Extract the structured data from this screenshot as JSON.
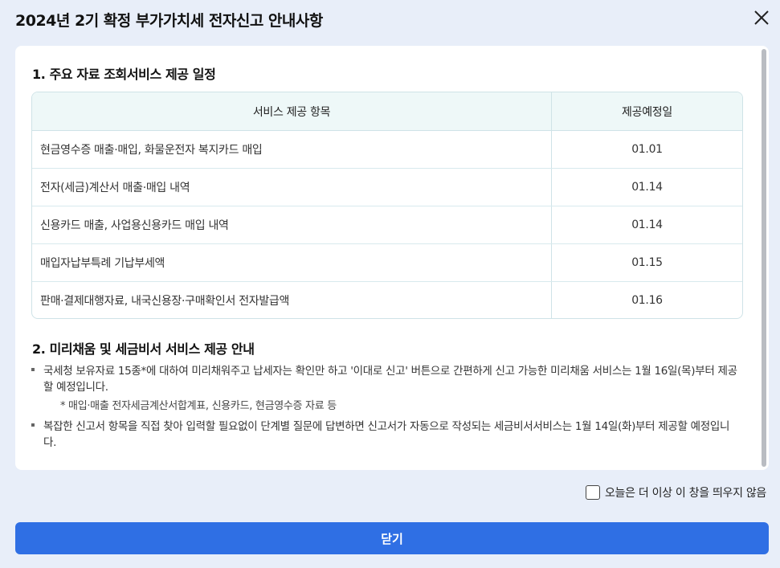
{
  "dialog": {
    "title": "2024년 2기 확정 부가가치세 전자신고 안내사항",
    "close_icon": "close-icon"
  },
  "section1": {
    "title": "1. 주요 자료 조회서비스 제공 일정",
    "table": {
      "headers": [
        "서비스 제공 항목",
        "제공예정일"
      ],
      "rows": [
        {
          "item": "현금영수증 매출·매입, 화물운전자 복지카드 매입",
          "date": "01.01"
        },
        {
          "item": "전자(세금)계산서 매출·매입 내역",
          "date": "01.14"
        },
        {
          "item": "신용카드 매출, 사업용신용카드 매입 내역",
          "date": "01.14"
        },
        {
          "item": "매입자납부특례 기납부세액",
          "date": "01.15"
        },
        {
          "item": "판매·결제대행자료, 내국신용장·구매확인서 전자발급액",
          "date": "01.16"
        }
      ]
    }
  },
  "section2": {
    "title": "2. 미리채움 및 세금비서 서비스 제공 안내",
    "bullet1": "국세청 보유자료 15종*에 대하여 미리채워주고 납세자는 확인만 하고 '이대로 신고' 버튼으로 간편하게 신고 가능한 미리채움 서비스는 1월 16일(목)부터 제공할 예정입니다.",
    "bullet1_note": "* 매입·매출 전자세금계산서합계표, 신용카드, 현금영수증 자료 등",
    "bullet2": "복잡한 신고서 항목을 직접 찾아 입력할 필요없이 단계별 질문에 답변하면 신고서가 자동으로 작성되는 세금비서서비스는 1월 14일(화)부터 제공할 예정입니다."
  },
  "footer": {
    "dont_show_label": "오늘은 더 이상 이 창을 띄우지 않음",
    "dont_show_checked": false,
    "close_button": "닫기"
  },
  "colors": {
    "background": "#e8eef9",
    "primary_button": "#2f6fe4",
    "table_header_bg": "#eef8f8"
  }
}
